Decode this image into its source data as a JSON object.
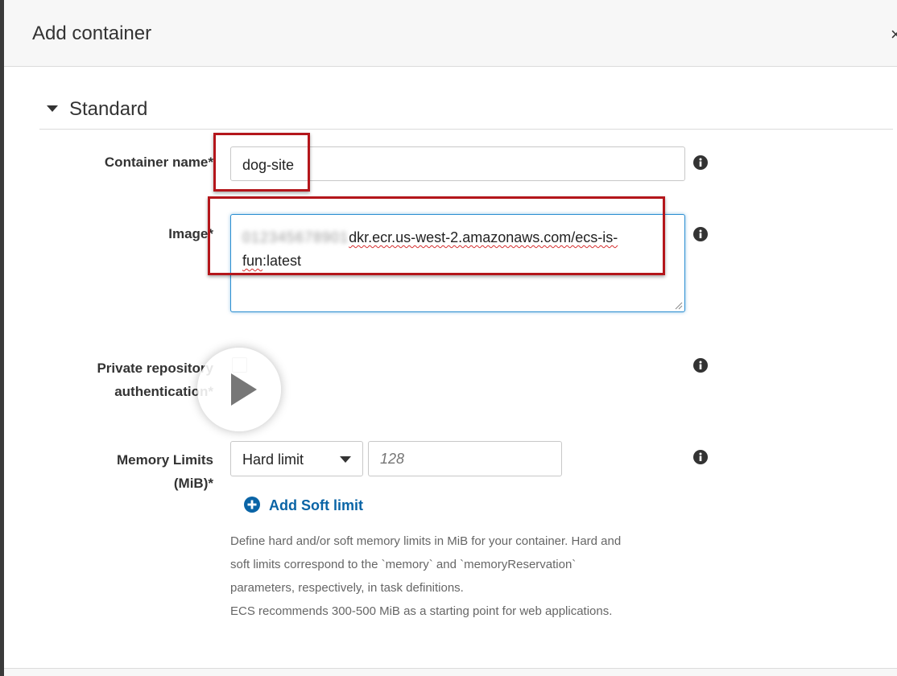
{
  "modal": {
    "title": "Add container",
    "close_glyph": "×"
  },
  "section": {
    "title": "Standard"
  },
  "fields": {
    "container_name": {
      "label": "Container name*",
      "value": "dog-site"
    },
    "image": {
      "label": "Image*",
      "value_blurred_prefix": "012345678901",
      "value_line1": "dkr.ecr.us-west-2.amazonaws.com/ecs-is-",
      "value_line2_a": "fun",
      "value_line2_b": ":latest"
    },
    "private_repo": {
      "label_line1": "Private repository",
      "label_line2": "authentication*",
      "checked": false
    },
    "memory": {
      "label_line1": "Memory Limits",
      "label_line2": "(MiB)*",
      "select_value": "Hard limit",
      "input_placeholder": "128",
      "add_soft_limit_label": "Add Soft limit",
      "help_line1": "Define hard and/or soft memory limits in MiB for your container. Hard and",
      "help_line2": "soft limits correspond to the `memory` and `memoryReservation`",
      "help_line3": "parameters, respectively, in task definitions.",
      "help_line4": "ECS recommends 300-500 MiB as a starting point for web applications."
    }
  },
  "icons": {
    "info": "info-icon",
    "caret": "caret-down-icon",
    "add": "plus-circle-icon",
    "play": "play-icon"
  },
  "colors": {
    "highlight_border": "#b4161b",
    "link_blue": "#0a64a6",
    "focus_blue": "#2b8ed1"
  }
}
